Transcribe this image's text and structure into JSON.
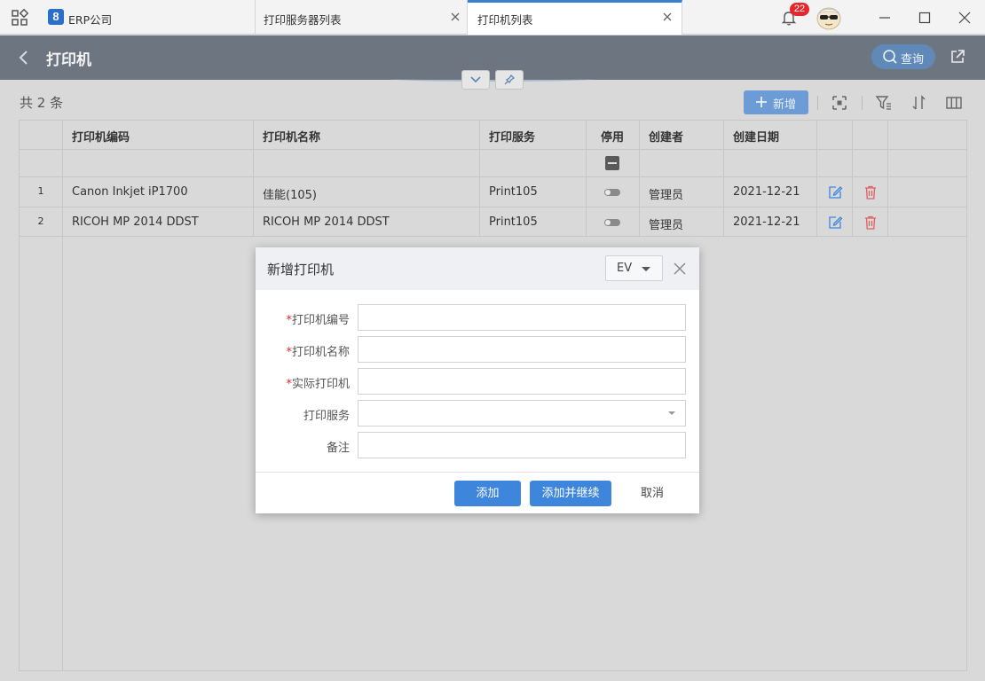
{
  "tabs": [
    {
      "label": "ERP公司"
    },
    {
      "label": "打印服务器列表"
    },
    {
      "label": "打印机列表"
    }
  ],
  "notifications": {
    "count": "22"
  },
  "header": {
    "title": "打印机",
    "query_label": "查询"
  },
  "toolbar": {
    "count_text": "共 2 条",
    "add_label": "新增"
  },
  "table": {
    "columns": [
      "打印机编码",
      "打印机名称",
      "打印服务",
      "停用",
      "创建者",
      "创建日期"
    ],
    "rows": [
      {
        "num": "1",
        "code": "Canon Inkjet iP1700",
        "name": "佳能(105)",
        "service": "Print105",
        "creator": "管理员",
        "date": "2021-12-21"
      },
      {
        "num": "2",
        "code": "RICOH MP 2014 DDST",
        "name": "RICOH MP 2014 DDST",
        "service": "Print105",
        "creator": "管理员",
        "date": "2021-12-21"
      }
    ]
  },
  "modal": {
    "title": "新增打印机",
    "lang": "EV",
    "fields": [
      {
        "label": "打印机编号",
        "required": "*",
        "value": ""
      },
      {
        "label": "打印机名称",
        "required": "*",
        "value": ""
      },
      {
        "label": "实际打印机",
        "required": "*",
        "value": ""
      },
      {
        "label": "打印服务",
        "required": "",
        "value": ""
      },
      {
        "label": "备注",
        "required": "",
        "value": ""
      }
    ],
    "buttons": {
      "add": "添加",
      "add_continue": "添加并继续",
      "cancel": "取消"
    }
  },
  "colors": {
    "accent": "#3e86dc",
    "header_bg": "#6d7680",
    "badge": "#e5262b",
    "delete": "#e06060"
  }
}
